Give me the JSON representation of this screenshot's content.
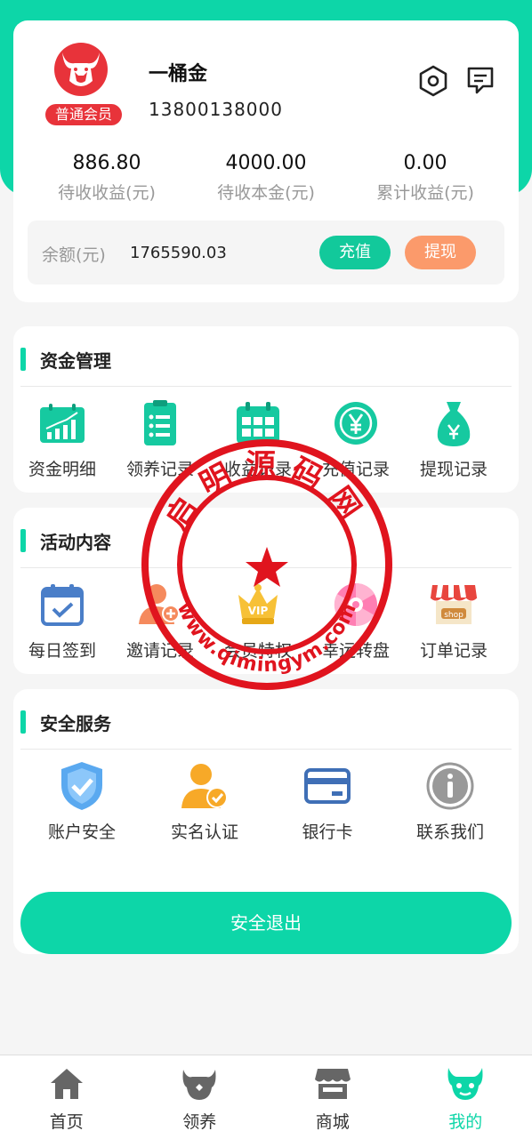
{
  "profile": {
    "name": "一桶金",
    "phone": "13800138000",
    "member_level": "普通会员"
  },
  "stats": [
    {
      "value": "886.80",
      "label": "待收收益(元)"
    },
    {
      "value": "4000.00",
      "label": "待收本金(元)"
    },
    {
      "value": "0.00",
      "label": "累计收益(元)"
    }
  ],
  "balance": {
    "label": "余额(元)",
    "value": "1765590.03",
    "recharge_label": "充值",
    "withdraw_label": "提现"
  },
  "sections": {
    "funds": {
      "title": "资金管理",
      "items": [
        {
          "label": "资金明细",
          "icon": "bar-chart-icon"
        },
        {
          "label": "领养记录",
          "icon": "clipboard-icon"
        },
        {
          "label": "收益记录",
          "icon": "calendar-grid-icon"
        },
        {
          "label": "充值记录",
          "icon": "yen-coin-icon"
        },
        {
          "label": "提现记录",
          "icon": "money-bag-icon"
        }
      ]
    },
    "activity": {
      "title": "活动内容",
      "items": [
        {
          "label": "每日签到",
          "icon": "calendar-check-icon"
        },
        {
          "label": "邀请记录",
          "icon": "invite-user-icon"
        },
        {
          "label": "会员特权",
          "icon": "vip-crown-icon"
        },
        {
          "label": "幸运转盘",
          "icon": "lucky-wheel-icon"
        },
        {
          "label": "订单记录",
          "icon": "shop-icon"
        }
      ]
    },
    "security": {
      "title": "安全服务",
      "items": [
        {
          "label": "账户安全",
          "icon": "shield-check-icon"
        },
        {
          "label": "实名认证",
          "icon": "verified-user-icon"
        },
        {
          "label": "银行卡",
          "icon": "bank-card-icon"
        },
        {
          "label": "联系我们",
          "icon": "info-icon"
        }
      ],
      "logout_label": "安全退出"
    }
  },
  "watermark": {
    "text": "启明源码网",
    "url": "www.qimingym.com"
  },
  "tabbar": [
    {
      "label": "首页",
      "icon": "home-icon",
      "active": false
    },
    {
      "label": "领养",
      "icon": "adopt-icon",
      "active": false
    },
    {
      "label": "商城",
      "icon": "store-icon",
      "active": false
    },
    {
      "label": "我的",
      "icon": "profile-icon",
      "active": true
    }
  ],
  "colors": {
    "accent": "#0dd6a8",
    "badge_red": "#e8333a",
    "withdraw_orange": "#fb9a6b",
    "stamp_red": "#e0141e"
  }
}
